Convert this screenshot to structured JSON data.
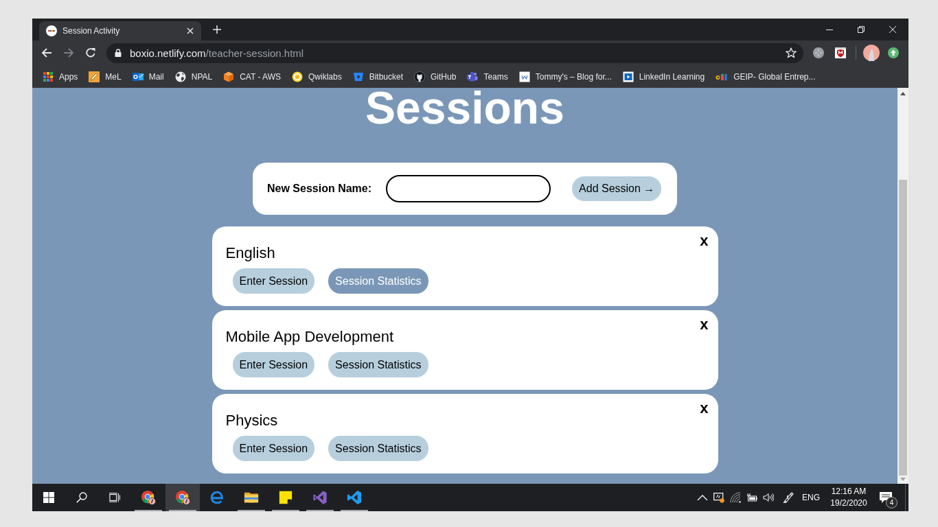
{
  "browser": {
    "tabs": [
      {
        "title": "Session Activity",
        "selected": true
      }
    ],
    "navigation": {
      "back_enabled": true,
      "forward_enabled": false
    },
    "address": {
      "host": "boxio.netlify.com",
      "path": "/teacher-session.html"
    },
    "bookmarks": [
      {
        "kind": "apps",
        "label": "Apps"
      },
      {
        "kind": "pencil",
        "label": "MeL"
      },
      {
        "kind": "mail",
        "label": "Mail"
      },
      {
        "kind": "globe",
        "label": "NPAL"
      },
      {
        "kind": "cube",
        "label": "CAT - AWS"
      },
      {
        "kind": "ring",
        "label": "Qwiklabs"
      },
      {
        "kind": "bucket",
        "label": "Bitbucket"
      },
      {
        "kind": "cat",
        "label": "GitHub"
      },
      {
        "kind": "people",
        "label": "Teams"
      },
      {
        "kind": "page",
        "label": "Tommy's – Blog for..."
      },
      {
        "kind": "play",
        "label": "LinkedIn Learning"
      },
      {
        "kind": "colorful",
        "label": "GEIP- Global Entrep..."
      }
    ]
  },
  "page": {
    "heading": "Sessions",
    "form": {
      "label": "New Session Name:",
      "button": "Add Session →"
    },
    "sessions": [
      {
        "name": "English",
        "close_label": "x",
        "actions": [
          {
            "label": "Enter Session",
            "hovered": false
          },
          {
            "label": "Session Statistics",
            "hovered": true
          }
        ]
      },
      {
        "name": "Mobile App Development",
        "close_label": "x",
        "actions": [
          {
            "label": "Enter Session",
            "hovered": false
          },
          {
            "label": "Session Statistics",
            "hovered": false
          }
        ]
      },
      {
        "name": "Physics",
        "close_label": "x",
        "actions": [
          {
            "label": "Enter Session",
            "hovered": false
          },
          {
            "label": "Session Statistics",
            "hovered": false
          }
        ]
      }
    ]
  },
  "taskbar": {
    "buttons": [
      {
        "kind": "start",
        "selected": false,
        "running": false
      },
      {
        "kind": "search",
        "selected": false,
        "running": false
      },
      {
        "kind": "task_view",
        "selected": false,
        "running": false
      },
      {
        "kind": "chrome",
        "selected": false,
        "running": true
      },
      {
        "kind": "chrome",
        "selected": true,
        "running": true
      },
      {
        "kind": "edge",
        "selected": false,
        "running": false
      },
      {
        "kind": "explorer",
        "selected": false,
        "running": true
      },
      {
        "kind": "sticky_notes",
        "selected": false,
        "running": true
      },
      {
        "kind": "visual_studio",
        "selected": false,
        "running": true
      },
      {
        "kind": "vscode",
        "selected": false,
        "running": true
      }
    ],
    "tray": {
      "language": "ENG",
      "time": "12:16 AM",
      "date": "19/2/2020",
      "notification_count": "4"
    }
  }
}
